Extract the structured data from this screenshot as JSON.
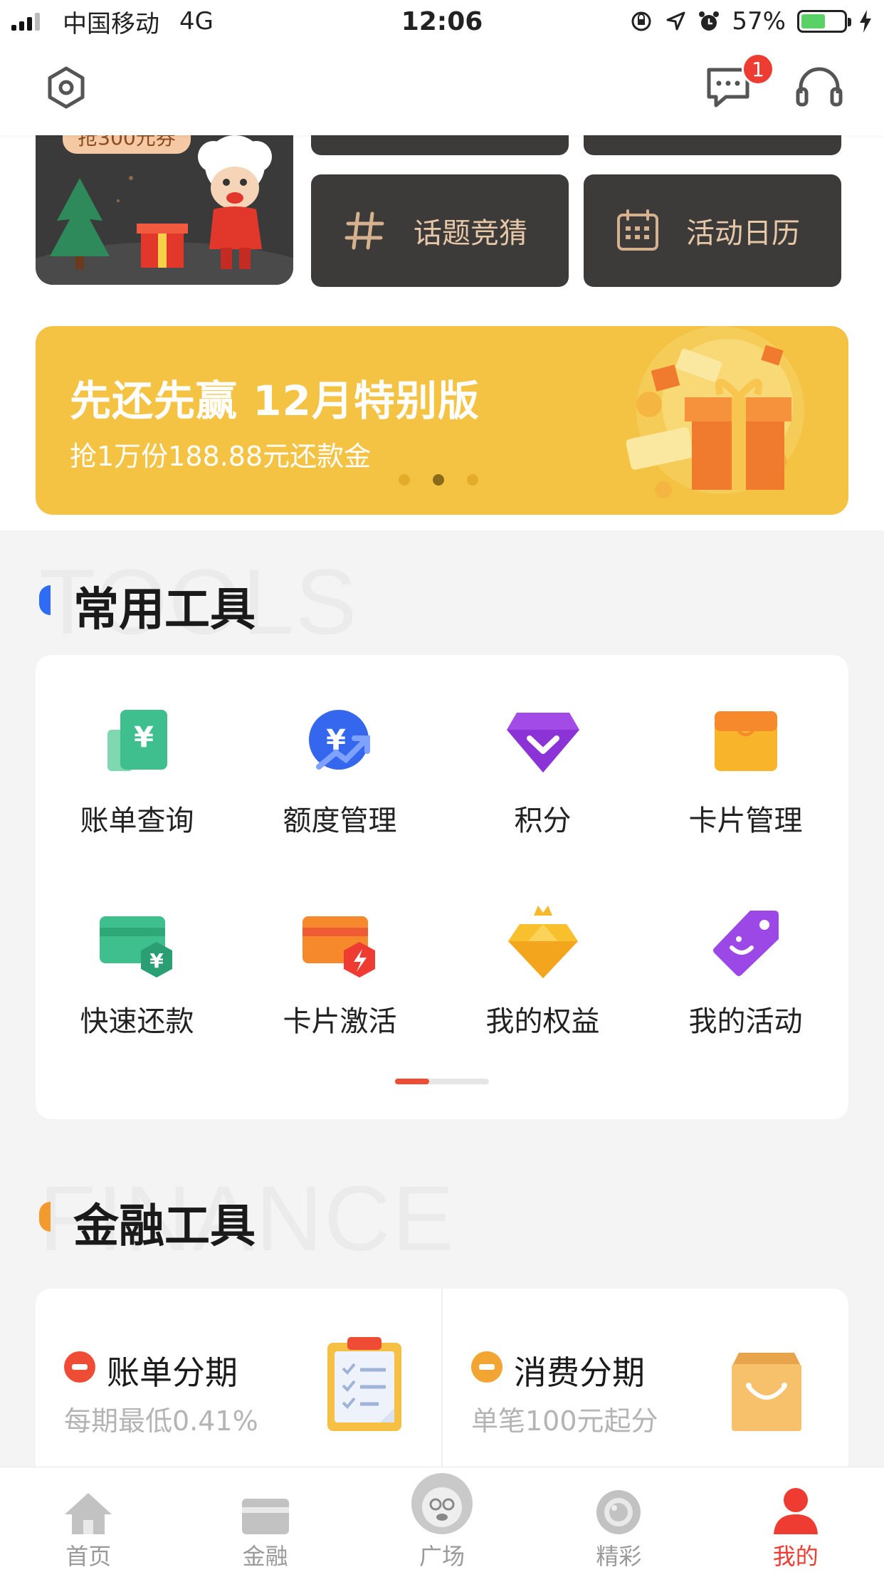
{
  "status_bar": {
    "carrier": "中国移动",
    "network": "4G",
    "time": "12:06",
    "battery": "57%",
    "battery_level": 0.57
  },
  "header": {
    "message_badge": "1",
    "icons": [
      "settings-hex-icon",
      "message-icon",
      "headset-icon"
    ]
  },
  "top_tiles": {
    "promo_tag": "抢300元券",
    "topic_label": "话题竞猜",
    "calendar_label": "活动日历"
  },
  "banner": {
    "title": "先还先赢 12月特别版",
    "subtitle": "抢1万份188.88元还款金",
    "slide_count": 3,
    "active_slide": 2
  },
  "tools_section": {
    "bg_text": "TOOLS",
    "title": "常用工具",
    "accent": "#2f6cf5",
    "items": [
      {
        "label": "账单查询",
        "icon": "bill-yen-icon"
      },
      {
        "label": "额度管理",
        "icon": "credit-limit-icon"
      },
      {
        "label": "积分",
        "icon": "diamond-points-icon"
      },
      {
        "label": "卡片管理",
        "icon": "card-wallet-icon"
      },
      {
        "label": "快速还款",
        "icon": "quick-repay-icon"
      },
      {
        "label": "卡片激活",
        "icon": "card-activate-icon"
      },
      {
        "label": "我的权益",
        "icon": "crown-gem-icon"
      },
      {
        "label": "我的活动",
        "icon": "activity-tag-icon"
      }
    ],
    "pager_page": 1,
    "pager_pages": 2
  },
  "finance_section": {
    "bg_text": "FINANCE",
    "title": "金融工具",
    "accent": "#f29a2e",
    "items": [
      {
        "title": "账单分期",
        "subtitle": "每期最低0.41%",
        "color": "#ef4c35",
        "icon": "clipboard-icon"
      },
      {
        "title": "消费分期",
        "subtitle": "单笔100元起分",
        "color": "#f3a534",
        "icon": "shopping-bag-icon"
      }
    ]
  },
  "tabbar": {
    "items": [
      {
        "label": "首页",
        "icon": "home-icon"
      },
      {
        "label": "金融",
        "icon": "card-icon"
      },
      {
        "label": "广场",
        "icon": "mascot-avatar-icon"
      },
      {
        "label": "精彩",
        "icon": "camera-lens-icon"
      },
      {
        "label": "我的",
        "icon": "person-icon",
        "active": true
      }
    ],
    "active_color": "#ef3c33"
  }
}
